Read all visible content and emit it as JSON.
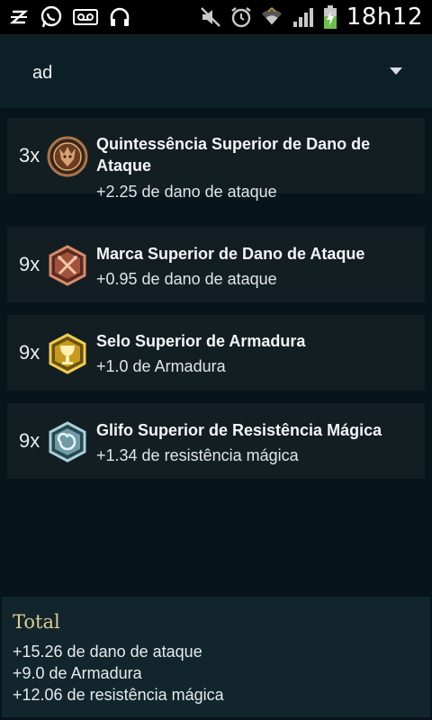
{
  "status_bar": {
    "time": "18h12",
    "left_icons": [
      "strikethrough-z-icon",
      "whatsapp-icon",
      "voicemail-icon",
      "headset-icon"
    ],
    "right_icons": [
      "mute-icon",
      "alarm-icon",
      "wifi-icon",
      "signal-icon",
      "battery-charging-icon"
    ]
  },
  "spinner": {
    "selected": "ad"
  },
  "runes": [
    {
      "qty": "3x",
      "name": "Quintessência Superior de Dano de Ataque",
      "desc": "+2.25 de dano de ataque",
      "icon": "quintessence-rune-icon"
    },
    {
      "qty": "9x",
      "name": "Marca Superior de Dano de Ataque",
      "desc": "+0.95 de dano de ataque",
      "icon": "mark-rune-icon"
    },
    {
      "qty": "9x",
      "name": "Selo Superior de Armadura",
      "desc": "+1.0 de Armadura",
      "icon": "seal-rune-icon"
    },
    {
      "qty": "9x",
      "name": "Glifo Superior de Resistência Mágica",
      "desc": "+1.34 de resistência mágica",
      "icon": "glyph-rune-icon"
    }
  ],
  "total": {
    "title": "Total",
    "lines": [
      "+15.26 de dano de ataque",
      "+9.0 de Armadura",
      "+12.06 de resistência mágica"
    ]
  },
  "colors": {
    "background": "#07141a",
    "header": "#0d2027",
    "card": "#131e22",
    "total_title": "#d9cc92"
  }
}
